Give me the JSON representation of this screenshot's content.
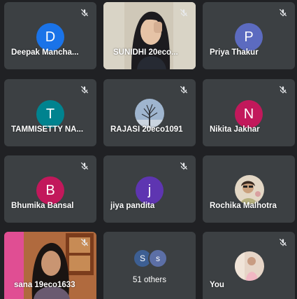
{
  "participants": [
    {
      "name": "Deepak Mancha...",
      "initial": "D",
      "color": "#1a73e8"
    },
    {
      "name": "SUNIDHI 20eco...",
      "video": true
    },
    {
      "name": "Priya Thakur",
      "initial": "P",
      "color": "#5c6bc0"
    },
    {
      "name": "TAMMISETTY NA...",
      "initial": "T",
      "color": "#00838f"
    },
    {
      "name": "RAJASI 20eco1091",
      "photo": "tree"
    },
    {
      "name": "Nikita Jakhar",
      "initial": "N",
      "color": "#c2185b"
    },
    {
      "name": "Bhumika Bansal",
      "initial": "B",
      "color": "#c2185b"
    },
    {
      "name": "jiya pandita",
      "initial": "j",
      "color": "#5e35b1"
    },
    {
      "name": "Rochika Malhotra",
      "photo": "person"
    },
    {
      "name": "sana 19eco1633",
      "video": true
    }
  ],
  "others": {
    "label": "51 others",
    "avatars": [
      "S",
      "s"
    ]
  },
  "self": {
    "name": "You"
  },
  "icons": {
    "mute": "mic-off-icon"
  }
}
